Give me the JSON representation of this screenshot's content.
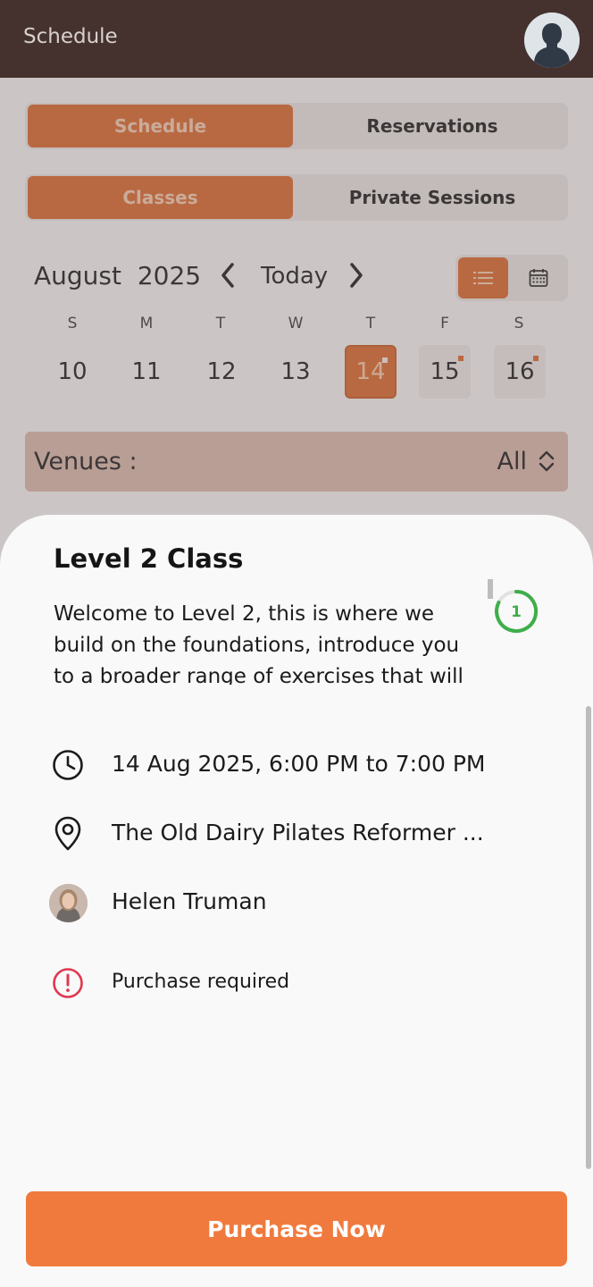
{
  "appbar": {
    "title": "Schedule",
    "avatar_icon": "user-silhouette-icon"
  },
  "top_tabs": [
    {
      "label": "Schedule",
      "active": true
    },
    {
      "label": "Reservations",
      "active": false
    }
  ],
  "type_tabs": [
    {
      "label": "Classes",
      "active": true
    },
    {
      "label": "Private Sessions",
      "active": false
    }
  ],
  "calendar": {
    "month": "August",
    "year": "2025",
    "today_label": "Today",
    "weekdays": [
      "S",
      "M",
      "T",
      "W",
      "T",
      "F",
      "S"
    ],
    "days": [
      {
        "num": "10",
        "selected": false,
        "has_event": false
      },
      {
        "num": "11",
        "selected": false,
        "has_event": false
      },
      {
        "num": "12",
        "selected": false,
        "has_event": false
      },
      {
        "num": "13",
        "selected": false,
        "has_event": false
      },
      {
        "num": "14",
        "selected": true,
        "has_event": true
      },
      {
        "num": "15",
        "selected": false,
        "has_event": true
      },
      {
        "num": "16",
        "selected": false,
        "has_event": true
      }
    ],
    "view": "list"
  },
  "venues": {
    "label": "Venues :",
    "value": "All"
  },
  "sheet": {
    "title": "Level 2 Class",
    "description": "Welcome to Level 2, this is where we build on the foundations, introduce you to a broader range of exercises that will",
    "spots_count": "1",
    "datetime": "14 Aug 2025, 6:00 PM to 7:00 PM",
    "location": "The Old Dairy Pilates Reformer ...",
    "instructor": "Helen Truman",
    "notice": "Purchase required",
    "cta": "Purchase Now"
  },
  "colors": {
    "appbar": "#45322f",
    "accent": "#d8682f",
    "cta": "#f07a3e",
    "ring": "#3fae4a",
    "alert": "#e0384f"
  }
}
